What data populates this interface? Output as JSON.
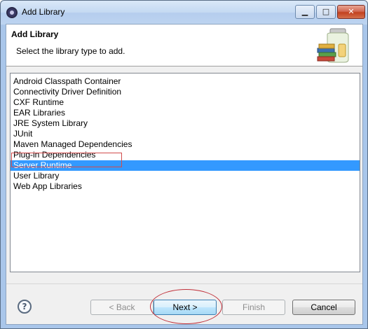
{
  "window": {
    "title": "Add Library",
    "icon": "eclipse-icon",
    "controls": {
      "minimize": "▁",
      "maximize": "□",
      "close": "✕"
    }
  },
  "header": {
    "title": "Add Library",
    "description": "Select the library type to add.",
    "icon": "library-jar-icon"
  },
  "library_types": {
    "items": [
      {
        "label": "Android Classpath Container",
        "selected": false
      },
      {
        "label": "Connectivity Driver Definition",
        "selected": false
      },
      {
        "label": "CXF Runtime",
        "selected": false
      },
      {
        "label": "EAR Libraries",
        "selected": false
      },
      {
        "label": "JRE System Library",
        "selected": false
      },
      {
        "label": "JUnit",
        "selected": false
      },
      {
        "label": "Maven Managed Dependencies",
        "selected": false
      },
      {
        "label": "Plug-in Dependencies",
        "selected": false
      },
      {
        "label": "Server Runtime",
        "selected": true
      },
      {
        "label": "User Library",
        "selected": false
      },
      {
        "label": "Web App Libraries",
        "selected": false
      }
    ]
  },
  "buttons": {
    "help": "?",
    "back": "< Back",
    "next": "Next >",
    "finish": "Finish",
    "cancel": "Cancel"
  },
  "colors": {
    "selection": "#3399ff",
    "annotation": "#d24b4b"
  }
}
